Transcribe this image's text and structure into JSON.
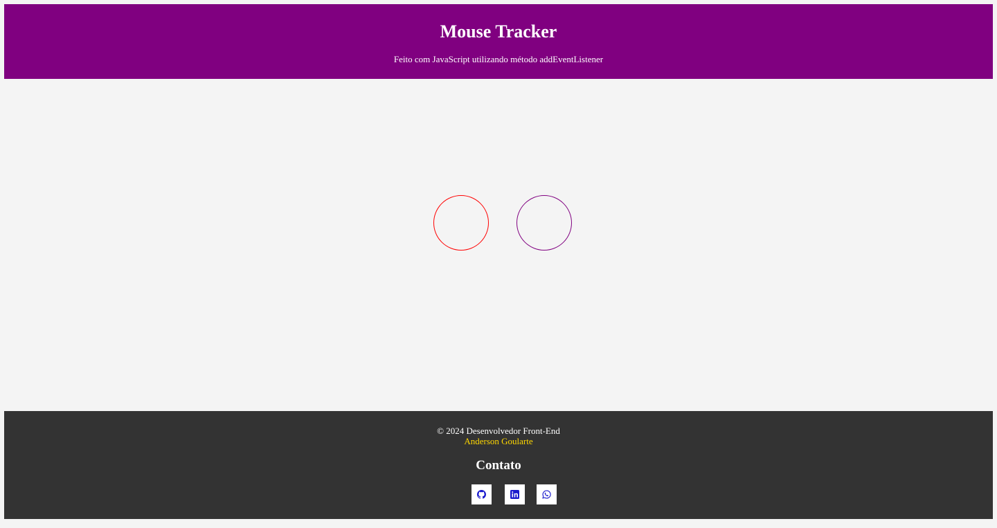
{
  "header": {
    "title": "Mouse Tracker",
    "subtitle": "Feito com JavaScript utilizando método addEventListener"
  },
  "tracker": {
    "left_circle_color": "#ff0000",
    "right_circle_color": "#800080"
  },
  "footer": {
    "copyright": "© 2024 Desenvolvedor Front-End",
    "author": "Anderson Goularte",
    "contact_title": "Contato",
    "socials": [
      {
        "icon": "github-icon"
      },
      {
        "icon": "linkedin-icon"
      },
      {
        "icon": "whatsapp-icon"
      }
    ]
  },
  "colors": {
    "header_bg": "#800080",
    "footer_bg": "#333333",
    "page_bg": "#f4f4f4",
    "author_link": "#ffd700",
    "icon_color": "#1a1acc"
  }
}
